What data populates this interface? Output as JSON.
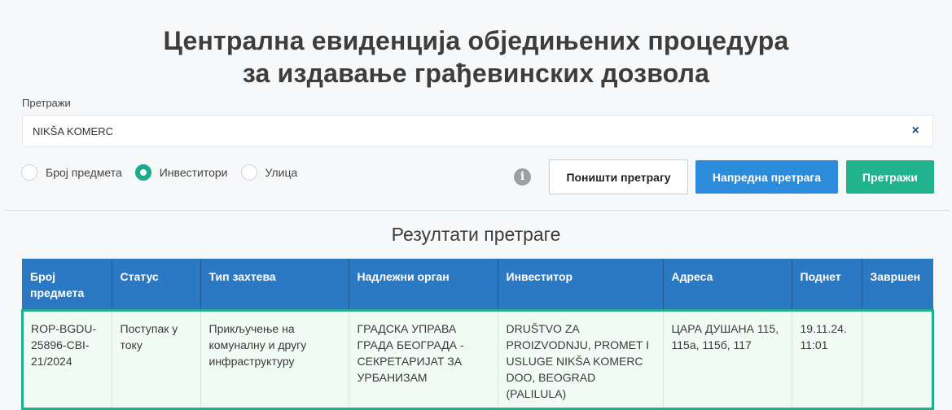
{
  "page": {
    "title_line1": "Централна евиденција обједињених процедура",
    "title_line2": "за издавање грађевинских дозвола"
  },
  "search": {
    "label": "Претражи",
    "value": "NIKŠA KOMERC",
    "clear_glyph": "×",
    "radios": [
      {
        "label": "Број предмета",
        "checked": false
      },
      {
        "label": "Инвеститори",
        "checked": true
      },
      {
        "label": "Улица",
        "checked": false
      }
    ],
    "info_glyph": "i",
    "reset_label": "Поништи претрагу",
    "advanced_label": "Напредна претрага",
    "search_label": "Претражи"
  },
  "results": {
    "title": "Резултати претраге",
    "headers": [
      "Број предмета",
      "Статус",
      "Тип захтева",
      "Надлежни орган",
      "Инвеститор",
      "Адреса",
      "Поднет",
      "Завршен"
    ],
    "rows": [
      [
        "ROP-BGDU-25896-CBI-21/2024",
        "Поступак у току",
        "Прикључење на комуналну и другу инфраструктуру",
        "ГРАДСКА УПРАВА ГРАДА БЕОГРАДА - СЕКРЕТАРИЈАТ ЗА УРБАНИЗАМ",
        "DRUŠTVO ZA PROIZVODNJU, PROMET I USLUGE NIKŠA KOMERC DOO, BEOGRAD (PALILULA)",
        "ЦАРА ДУШАНА 115, 115а, 115б, 117",
        "19.11.24. 11:01",
        ""
      ]
    ]
  },
  "colors": {
    "header_bg": "#2b79c2",
    "row_highlight": "#1db08a",
    "advanced_btn": "#2d8bdb",
    "search_btn": "#20b38e"
  }
}
